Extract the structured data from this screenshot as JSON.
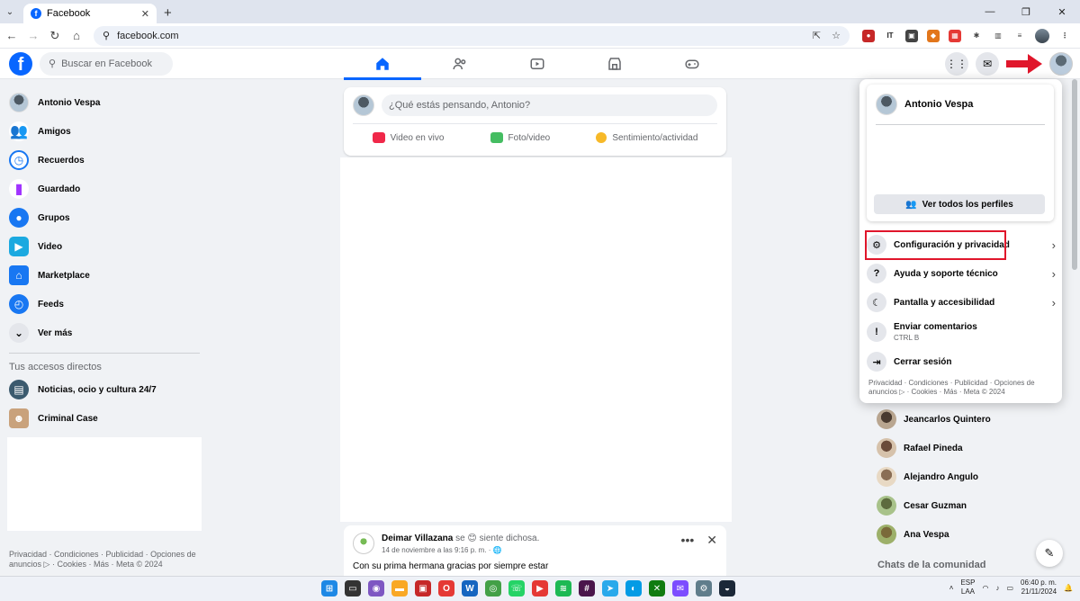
{
  "browser": {
    "tab_title": "Facebook",
    "url": "facebook.com"
  },
  "fb": {
    "search_placeholder": "Buscar en Facebook",
    "user_name": "Antonio Vespa"
  },
  "left_nav": {
    "items": [
      {
        "label": "Antonio Vespa",
        "icon": "avatar"
      },
      {
        "label": "Amigos",
        "icon": "friends-icon",
        "color": "#1877f2"
      },
      {
        "label": "Recuerdos",
        "icon": "clock-icon",
        "color": "#1877f2"
      },
      {
        "label": "Guardado",
        "icon": "bookmark-icon",
        "color": "#a033ff"
      },
      {
        "label": "Grupos",
        "icon": "groups-icon",
        "color": "#1877f2"
      },
      {
        "label": "Video",
        "icon": "video-icon",
        "color": "#1ba9e0"
      },
      {
        "label": "Marketplace",
        "icon": "marketplace-icon",
        "color": "#1877f2"
      },
      {
        "label": "Feeds",
        "icon": "feeds-icon",
        "color": "#1877f2"
      },
      {
        "label": "Ver más",
        "icon": "chevron-down-icon"
      }
    ],
    "shortcuts_heading": "Tus accesos directos",
    "shortcuts": [
      {
        "label": "Noticias, ocio y cultura 24/7"
      },
      {
        "label": "Criminal Case"
      }
    ],
    "footer": "Privacidad · Condiciones · Publicidad · Opciones de anuncios ▷ · Cookies · Más · Meta © 2024"
  },
  "composer": {
    "placeholder": "¿Qué estás pensando, Antonio?",
    "actions": [
      "Video en vivo",
      "Foto/video",
      "Sentimiento/actividad"
    ]
  },
  "post": {
    "author": "Deimar Villazana",
    "feeling": "se 😊 siente dichosa.",
    "time": "14 de noviembre a las 9:16 p. m. · ",
    "text": "Con su prima hermana gracias por siempre estar"
  },
  "account_menu": {
    "profile_name": "Antonio Vespa",
    "see_all_profiles": "Ver todos los perfiles",
    "items": [
      {
        "label": "Configuración y privacidad",
        "icon": "gear-icon",
        "has_chevron": true
      },
      {
        "label": "Ayuda y soporte técnico",
        "icon": "help-icon",
        "has_chevron": true
      },
      {
        "label": "Pantalla y accesibilidad",
        "icon": "moon-icon",
        "has_chevron": true
      },
      {
        "label": "Enviar comentarios",
        "sub": "CTRL B",
        "icon": "feedback-icon",
        "has_chevron": false
      },
      {
        "label": "Cerrar sesión",
        "icon": "logout-icon",
        "has_chevron": false
      }
    ],
    "footer": "Privacidad · Condiciones · Publicidad · Opciones de anuncios ▷ · Cookies · Más · Meta © 2024",
    "highlight_color": "#e0162b"
  },
  "contacts": [
    "Jeancarlos Quintero",
    "Rafael Pineda",
    "Alejandro Angulo",
    "Cesar Guzman",
    "Ana Vespa"
  ],
  "community_chats_heading": "Chats de la comunidad",
  "taskbar": {
    "lang_line1": "ESP",
    "lang_line2": "LAA",
    "time": "06:40 p. m.",
    "date": "21/11/2024"
  },
  "colors": {
    "brand": "#0866ff",
    "arrow": "#e0162b"
  }
}
